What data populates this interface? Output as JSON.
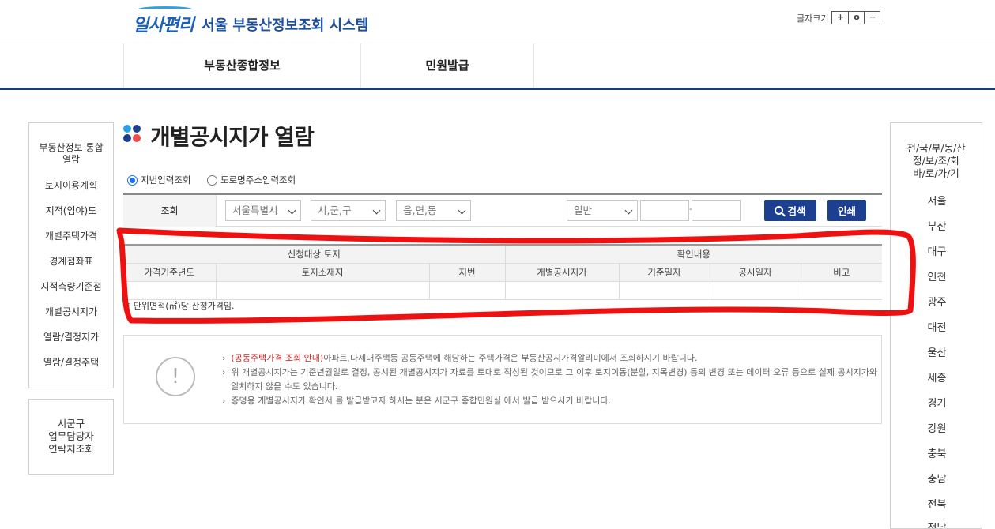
{
  "header": {
    "logo_text": "일사편리",
    "site_title": "서울 부동산정보조회 시스템",
    "font_size_label": "글자크기",
    "font_size_buttons": [
      "+",
      "o",
      "−"
    ]
  },
  "gnb": [
    "부동산종합정보",
    "민원발급"
  ],
  "left_sidebar": {
    "items": [
      "부동산정보 통합\n열람",
      "토지이용계획",
      "지적(임야)도",
      "개별주택가격",
      "경계점좌표",
      "지적측량기준점",
      "개별공시지가",
      "열람/결정지가",
      "열람/결정주택"
    ],
    "contact": "시군구\n업무담당자\n연락처조회"
  },
  "right_sidebar": {
    "title": "전/국/부/동/산\n정/보/조/회\n바/로/가/기",
    "cities": [
      "서울",
      "부산",
      "대구",
      "인천",
      "광주",
      "대전",
      "울산",
      "세종",
      "경기",
      "강원",
      "충북",
      "충남",
      "전북",
      "전남"
    ]
  },
  "page": {
    "title": "개별공시지가 열람",
    "radio_options": [
      {
        "label": "지번입력조회",
        "checked": true
      },
      {
        "label": "도로명주소입력조회",
        "checked": false
      }
    ],
    "form": {
      "label": "조회",
      "sido": "서울특별시",
      "sigungu": "시,군,구",
      "eupmyeondong": "읍,면,동",
      "land_type": "일반",
      "dash": "-",
      "search_button": "검색",
      "print_button": "인쇄"
    },
    "table": {
      "group_headers": [
        "신청대상 토지",
        "확인내용"
      ],
      "columns": [
        "가격기준년도",
        "토지소재지",
        "지번",
        "개별공시지가",
        "기준일자",
        "공시일자",
        "비고"
      ]
    },
    "unit_note": "※ 단위면적(㎡)당 산정가격임.",
    "info": {
      "icon": "!",
      "line1_red": "(공동주택가격 조회 안내)",
      "line1_rest": "아파트,다세대주택등 공동주택에 해당하는 주택가격은 부동산공시가격알리미에서 조회하시기 바랍니다.",
      "line2": "위 개별공시지가는 기준년월일로 결정, 공시된 개별공시지가 자료를 토대로 작성된 것이므로 그 이후 토지이동(분할, 지목변경) 등의 변경 또는 데이터 오류 등으로 실제 공시지가와",
      "line2b": "일치하지 않을 수도 있습니다.",
      "line3": "증명용 개별공시지가 확인서 를 발급받고자 하시는 분은 시군구 종합민원실 에서 발급 받으시기 바랍니다."
    }
  },
  "colors": {
    "navy": "#1a3d7c",
    "button": "#1d3f8f",
    "annotation": "#ee1111"
  }
}
